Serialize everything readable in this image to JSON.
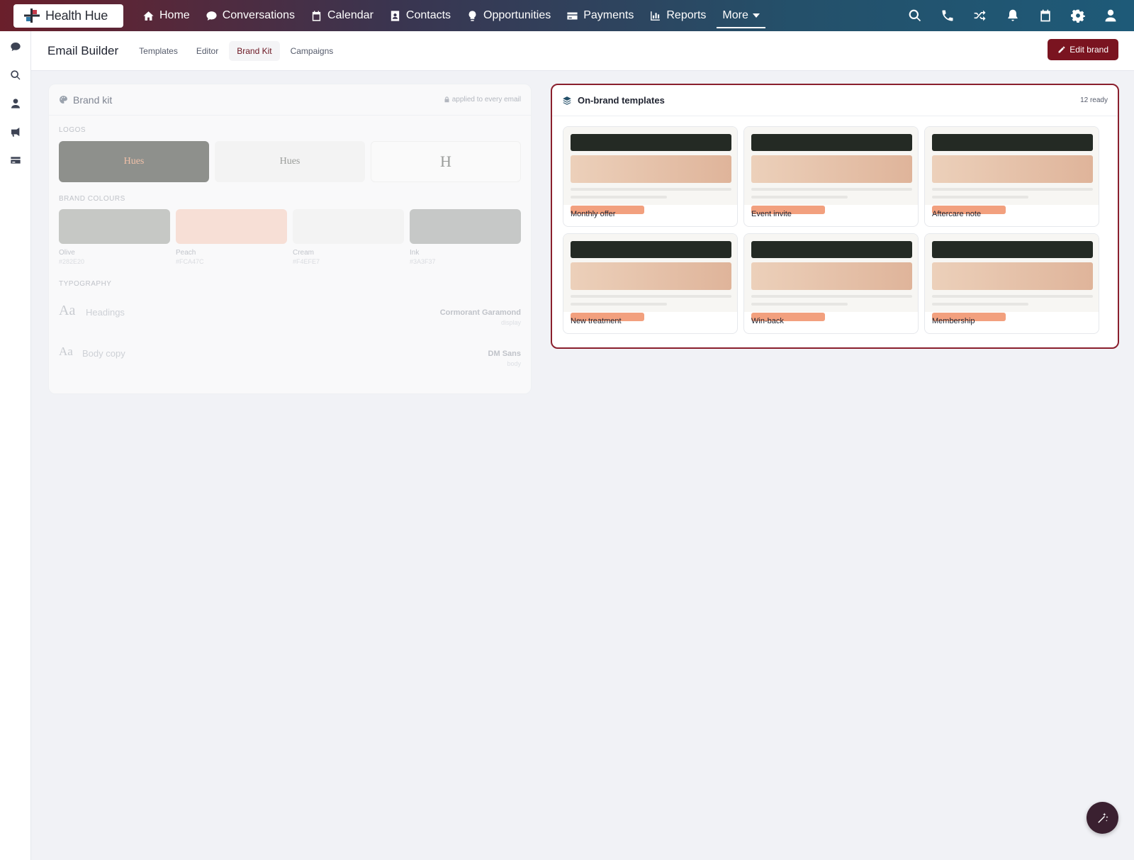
{
  "app": {
    "brand_name": "Health Hue",
    "nav": [
      {
        "label": "Home",
        "icon": "home-icon"
      },
      {
        "label": "Conversations",
        "icon": "chat-icon"
      },
      {
        "label": "Calendar",
        "icon": "calendar-icon"
      },
      {
        "label": "Contacts",
        "icon": "contact-card-icon"
      },
      {
        "label": "Opportunities",
        "icon": "lightbulb-icon"
      },
      {
        "label": "Payments",
        "icon": "credit-card-icon"
      },
      {
        "label": "Reports",
        "icon": "bar-chart-icon"
      }
    ],
    "more_label": "More",
    "top_icons": [
      "search-icon",
      "phone-icon",
      "shuffle-icon",
      "bell-icon",
      "calendar-icon",
      "gear-icon",
      "user-icon"
    ],
    "rail_icons": [
      "chat-icon",
      "search-icon",
      "user-icon",
      "megaphone-icon",
      "credit-card-icon"
    ]
  },
  "page": {
    "title": "Email Builder",
    "tabs": [
      "Templates",
      "Editor",
      "Brand Kit",
      "Campaigns"
    ],
    "active_tab": "Brand Kit",
    "edit_button": "Edit brand"
  },
  "brand_kit": {
    "title": "Brand kit",
    "applied_note": "applied to every email",
    "logos_label": "LOGOS",
    "logos": [
      {
        "text": "Hues",
        "variant": "dark"
      },
      {
        "text": "Hues",
        "variant": "light"
      },
      {
        "text": "H",
        "variant": "mark"
      }
    ],
    "colours_label": "BRAND COLOURS",
    "colours": [
      {
        "name": "Olive",
        "hex": "#282E20",
        "display": "#c6c8c5"
      },
      {
        "name": "Peach",
        "hex": "#FCA47C",
        "display": "#f7dfd6"
      },
      {
        "name": "Cream",
        "hex": "#F4EFE7",
        "display": "#f3f3f3"
      },
      {
        "name": "Ink",
        "hex": "#3A3F37",
        "display": "#c6c8c7"
      }
    ],
    "typography_label": "TYPOGRAPHY",
    "typography": [
      {
        "sample": "Aa",
        "label": "Headings",
        "font": "Cormorant Garamond",
        "role": "display"
      },
      {
        "sample": "Aa",
        "label": "Body copy",
        "font": "DM Sans",
        "role": "body"
      }
    ]
  },
  "templates": {
    "title": "On-brand templates",
    "ready": "12 ready",
    "items": [
      "Monthly offer",
      "Event invite",
      "Aftercare note",
      "New treatment",
      "Win-back",
      "Membership"
    ]
  },
  "colors": {
    "accent": "#7a1420",
    "highlight_border": "#8a1f2d",
    "peach": "#f2a07e",
    "dark_bar": "#242a24"
  }
}
